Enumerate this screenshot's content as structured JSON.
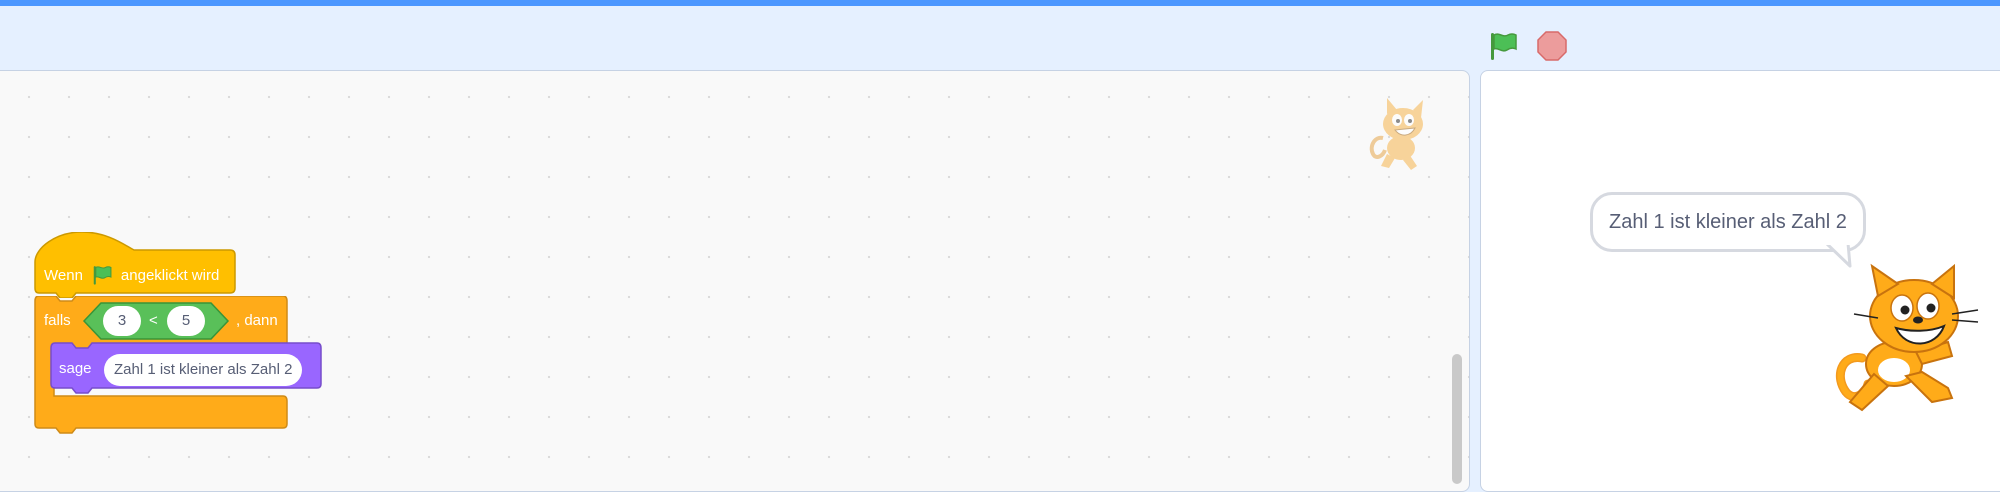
{
  "toolbar": {
    "green_flag": "green-flag-icon",
    "stop": "stop-icon"
  },
  "workspace": {
    "sprite_thumbnail": "scratch-cat-icon",
    "scripts": [
      {
        "hat": {
          "pre": "Wenn",
          "icon": "green-flag-icon",
          "post": "angeklickt wird"
        },
        "if": {
          "label": "falls",
          "then": ", dann",
          "condition": {
            "left": "3",
            "operator": "<",
            "right": "5"
          },
          "body": [
            {
              "label": "sage",
              "value": "Zahl 1 ist kleiner als Zahl 2"
            }
          ]
        }
      }
    ]
  },
  "stage": {
    "speech_bubble": "Zahl 1 ist kleiner als Zahl 2",
    "sprite": "scratch-cat-icon"
  },
  "colors": {
    "events": "#ffbf00",
    "control": "#ffab19",
    "operators": "#59c059",
    "looks": "#9966ff",
    "accent": "#4c97ff"
  }
}
